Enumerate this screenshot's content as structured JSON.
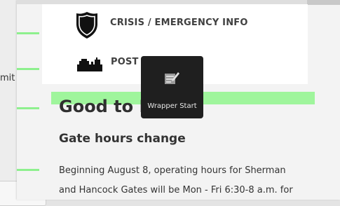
{
  "sidebar": {
    "truncated_text": "mit"
  },
  "nav": {
    "items": [
      {
        "label": "CRISIS / EMERGENCY INFO",
        "icon": "shield-icon"
      },
      {
        "label": "POST",
        "icon": "installation-icon"
      }
    ]
  },
  "content": {
    "title": "Good to K",
    "subheading": "Gate hours change",
    "body_lines": [
      "Beginning August 8, operating hours for Sherman",
      "and Hancock Gates will be Mon - Fri 6:30-8 a.m. for"
    ]
  },
  "tooltip": {
    "label": "Wrapper Start",
    "icon": "wrapper-edit-icon"
  },
  "colors": {
    "highlight_green": "#9ff59c",
    "tooltip_bg": "#1f1f1f"
  }
}
